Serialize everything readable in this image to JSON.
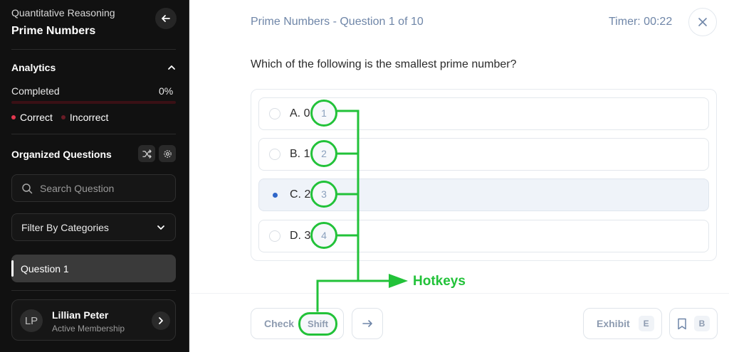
{
  "sidebar": {
    "topic": "Quantitative Reasoning",
    "title": "Prime Numbers",
    "analytics_label": "Analytics",
    "completed_label": "Completed",
    "completed_pct": "0%",
    "progress_fraction": 0,
    "legend": {
      "correct": "Correct",
      "incorrect": "Incorrect"
    },
    "organized_label": "Organized Questions",
    "search": {
      "placeholder": "Search Question",
      "value": ""
    },
    "filter_label": "Filter By Categories",
    "questions": [
      "Question 1"
    ],
    "user": {
      "initials": "LP",
      "name": "Lillian Peter",
      "membership": "Active Membership"
    }
  },
  "main": {
    "header": "Prime Numbers - Question 1 of 10",
    "timer": "Timer: 00:22",
    "question": "Which of the following is the smallest prime number?",
    "options": [
      {
        "label": "A. 0",
        "hotkey": "1",
        "selected": false
      },
      {
        "label": "B. 1",
        "hotkey": "2",
        "selected": false
      },
      {
        "label": "C. 2",
        "hotkey": "3",
        "selected": true
      },
      {
        "label": "D. 3",
        "hotkey": "4",
        "selected": false
      }
    ],
    "annotation_label": "Hotkeys",
    "footer": {
      "check_label": "Check",
      "check_key": "Shift",
      "exhibit_label": "Exhibit",
      "exhibit_key": "E",
      "bookmark_key": "B"
    }
  },
  "colors": {
    "sidebar_bg": "#111111",
    "accent_red": "#e2384f",
    "muted_blue": "#6f86a8",
    "selected_blue": "#2f66c9",
    "annotation_green": "#22c239"
  },
  "icons": [
    "arrow-left-icon",
    "chevron-up-icon",
    "shuffle-icon",
    "gear-icon",
    "search-icon",
    "chevron-down-icon",
    "chevron-right-icon",
    "close-icon",
    "arrow-right-icon",
    "bookmark-icon"
  ]
}
